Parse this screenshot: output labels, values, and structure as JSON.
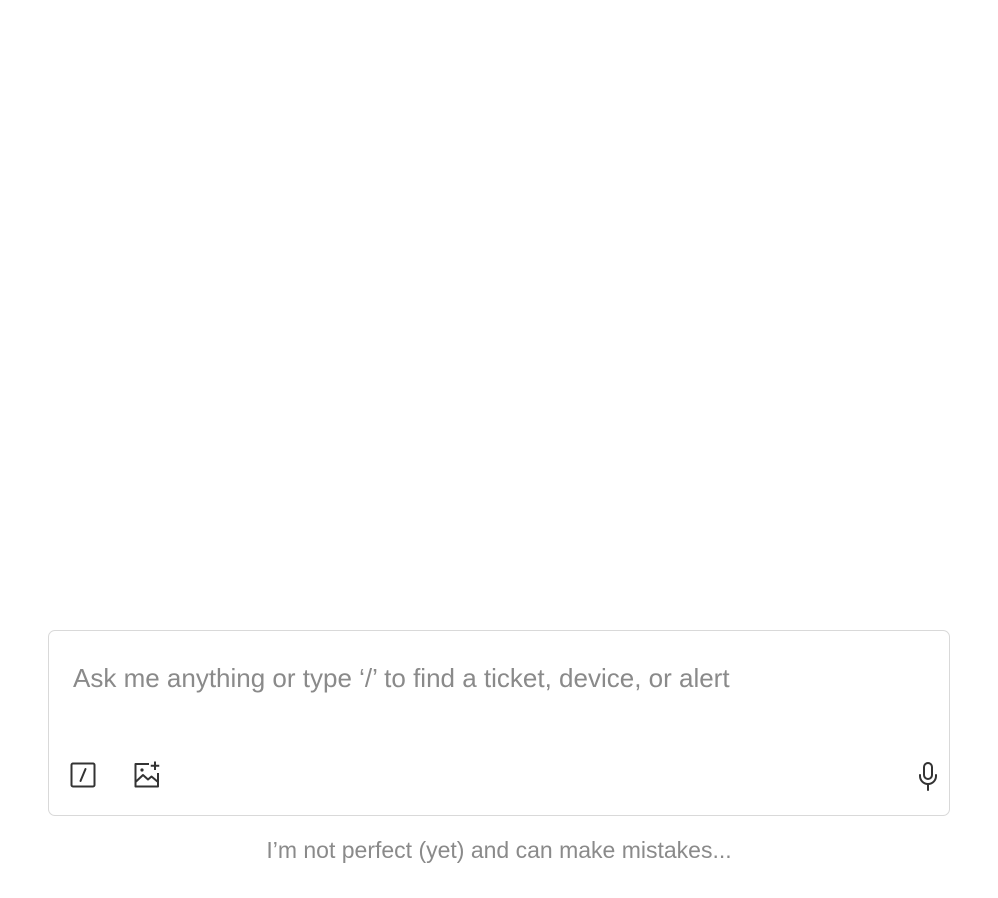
{
  "composer": {
    "placeholder": "Ask me anything or type ‘/’ to find a ticket, device, or alert",
    "value": ""
  },
  "toolbar": {
    "command_icon": "slash-command-icon",
    "image_icon": "add-image-icon",
    "mic_icon": "microphone-icon"
  },
  "footer": {
    "disclaimer": "I’m not perfect (yet) and can make mistakes..."
  },
  "colors": {
    "border": "#d9d9d9",
    "placeholder": "#8a8a8a",
    "icon": "#333333",
    "background": "#ffffff"
  }
}
